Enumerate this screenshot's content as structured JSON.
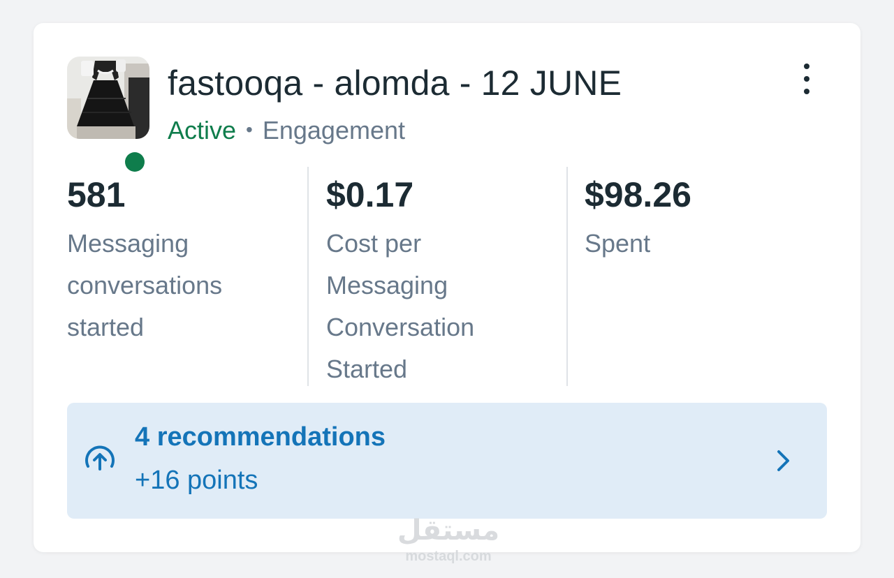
{
  "campaign": {
    "title": "fastooqa - alomda - 12 JUNE",
    "status": "Active",
    "separator": "•",
    "objective": "Engagement",
    "status_color": "#0f7d4c"
  },
  "menu": {
    "icon": "more-vertical-icon"
  },
  "stats": [
    {
      "value": "581",
      "label_lines": [
        "Messaging",
        "conversations",
        "started"
      ]
    },
    {
      "value": "$0.17",
      "label_lines": [
        "Cost per",
        "Messaging",
        "Conversation",
        "Started"
      ]
    },
    {
      "value": "$98.26",
      "label_lines": [
        "Spent"
      ]
    }
  ],
  "recommendations": {
    "title": "4 recommendations",
    "subtitle": "+16 points",
    "icon": "arrow-up-circle-icon",
    "chevron_icon": "chevron-right-icon",
    "accent": "#1474b8",
    "background": "#e0ecf7"
  },
  "watermark": {
    "arabic": "مستقل",
    "domain": "mostaql.com"
  }
}
